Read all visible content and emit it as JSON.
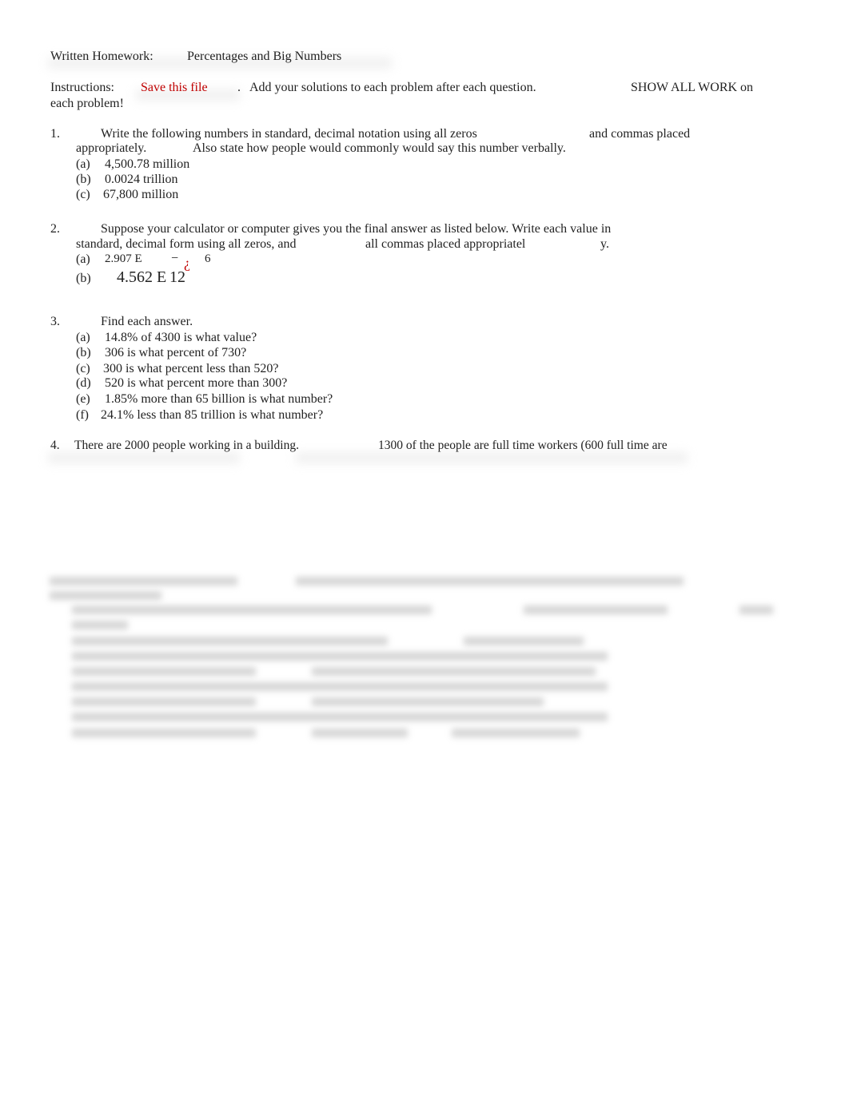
{
  "header": {
    "label": "Written Homework:",
    "title": "Percentages and Big Numbers"
  },
  "instructions": {
    "label": "Instructions:",
    "highlight": "Save this file",
    "period": ".",
    "text": "Add your solutions to each problem after each question.",
    "emphasis": "SHOW ALL WORK on",
    "continuation": "each problem!",
    "accent_color": "#c00000"
  },
  "problems": [
    {
      "number": "1.",
      "line1a": "Write the following numbers in standard, decimal notation using all zeros",
      "line1b": "and commas placed",
      "line2a": "appropriately.",
      "line2b": "Also state how people would commonly would say this number verbally.",
      "parts": [
        {
          "label": "(a)",
          "text": "4,500.78 million"
        },
        {
          "label": "(b)",
          "text": "0.0024 trillion"
        },
        {
          "label": "(c)",
          "text": "67,800 million"
        }
      ]
    },
    {
      "number": "2.",
      "line1": "Suppose your calculator or computer gives you the final answer as listed below. Write each value in",
      "line2a": "standard, decimal form using all zeros, and",
      "line2b": "all commas placed appropriatel",
      "line2c": "y.",
      "parts": [
        {
          "label": "(a)",
          "text": "2.907 E",
          "minus": "−",
          "glyph": "¿",
          "exponent": "6"
        },
        {
          "label": "(b)",
          "text": "4.562 E",
          "exponent": "12"
        }
      ]
    },
    {
      "number": "3.",
      "line1": "Find each answer.",
      "parts": [
        {
          "label": "(a)",
          "text": "14.8% of 4300 is what value?"
        },
        {
          "label": "(b)",
          "text": "306 is what percent of 730?"
        },
        {
          "label": "(c)",
          "text": "300 is what percent less than 520?"
        },
        {
          "label": "(d)",
          "text": "520 is what percent more than 300?"
        },
        {
          "label": "(e)",
          "text": "1.85% more than 65 billion is what number?"
        },
        {
          "label": "(f)",
          "text": "24.1% less than 85 trillion is what number?"
        }
      ]
    },
    {
      "number": "4.",
      "line1a": "There are 2000 people working in a building.",
      "line1b": "1300 of the people are full time workers (600 full time are"
    }
  ]
}
